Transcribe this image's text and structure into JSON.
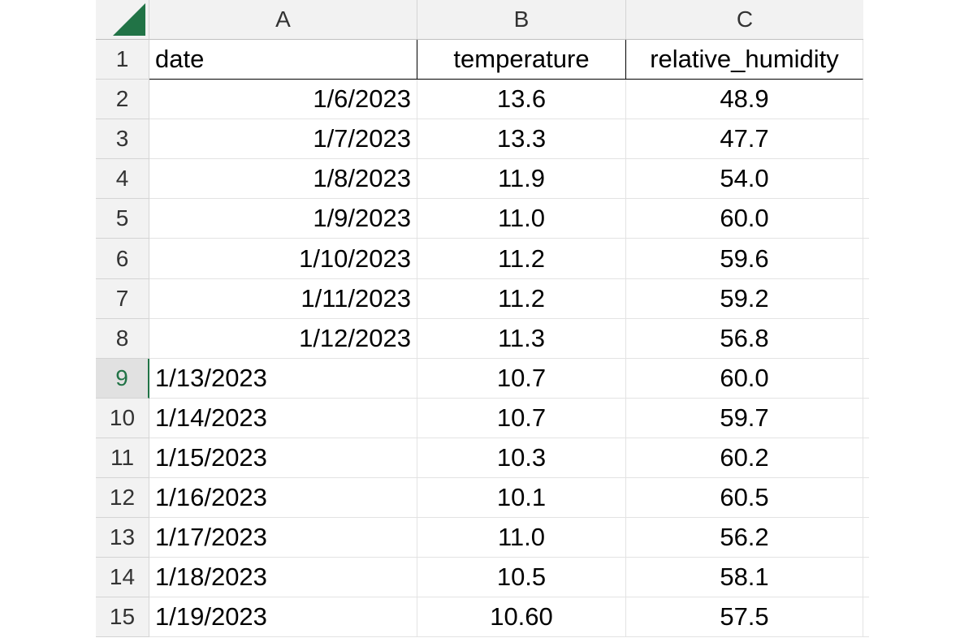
{
  "columns": [
    "A",
    "B",
    "C"
  ],
  "header": {
    "row_number": "1",
    "date": "date",
    "temperature": "temperature",
    "humidity": "relative_humidity"
  },
  "rows": [
    {
      "num": "2",
      "date": "1/6/2023",
      "temperature": "13.6",
      "humidity": "48.9",
      "date_align": "right"
    },
    {
      "num": "3",
      "date": "1/7/2023",
      "temperature": "13.3",
      "humidity": "47.7",
      "date_align": "right"
    },
    {
      "num": "4",
      "date": "1/8/2023",
      "temperature": "11.9",
      "humidity": "54.0",
      "date_align": "right"
    },
    {
      "num": "5",
      "date": "1/9/2023",
      "temperature": "11.0",
      "humidity": "60.0",
      "date_align": "right"
    },
    {
      "num": "6",
      "date": "1/10/2023",
      "temperature": "11.2",
      "humidity": "59.6",
      "date_align": "right"
    },
    {
      "num": "7",
      "date": "1/11/2023",
      "temperature": "11.2",
      "humidity": "59.2",
      "date_align": "right"
    },
    {
      "num": "8",
      "date": "1/12/2023",
      "temperature": "11.3",
      "humidity": "56.8",
      "date_align": "right"
    },
    {
      "num": "9",
      "date": "1/13/2023",
      "temperature": "10.7",
      "humidity": "60.0",
      "date_align": "left",
      "active": true
    },
    {
      "num": "10",
      "date": "1/14/2023",
      "temperature": "10.7",
      "humidity": "59.7",
      "date_align": "left"
    },
    {
      "num": "11",
      "date": "1/15/2023",
      "temperature": "10.3",
      "humidity": "60.2",
      "date_align": "left"
    },
    {
      "num": "12",
      "date": "1/16/2023",
      "temperature": "10.1",
      "humidity": "60.5",
      "date_align": "left"
    },
    {
      "num": "13",
      "date": "1/17/2023",
      "temperature": "11.0",
      "humidity": "56.2",
      "date_align": "left"
    },
    {
      "num": "14",
      "date": "1/18/2023",
      "temperature": "10.5",
      "humidity": "58.1",
      "date_align": "left"
    },
    {
      "num": "15",
      "date": "1/19/2023",
      "temperature": "10.60",
      "humidity": "57.5",
      "date_align": "left"
    }
  ],
  "colors": {
    "accent": "#217346",
    "header_bg": "#f2f2f2"
  }
}
